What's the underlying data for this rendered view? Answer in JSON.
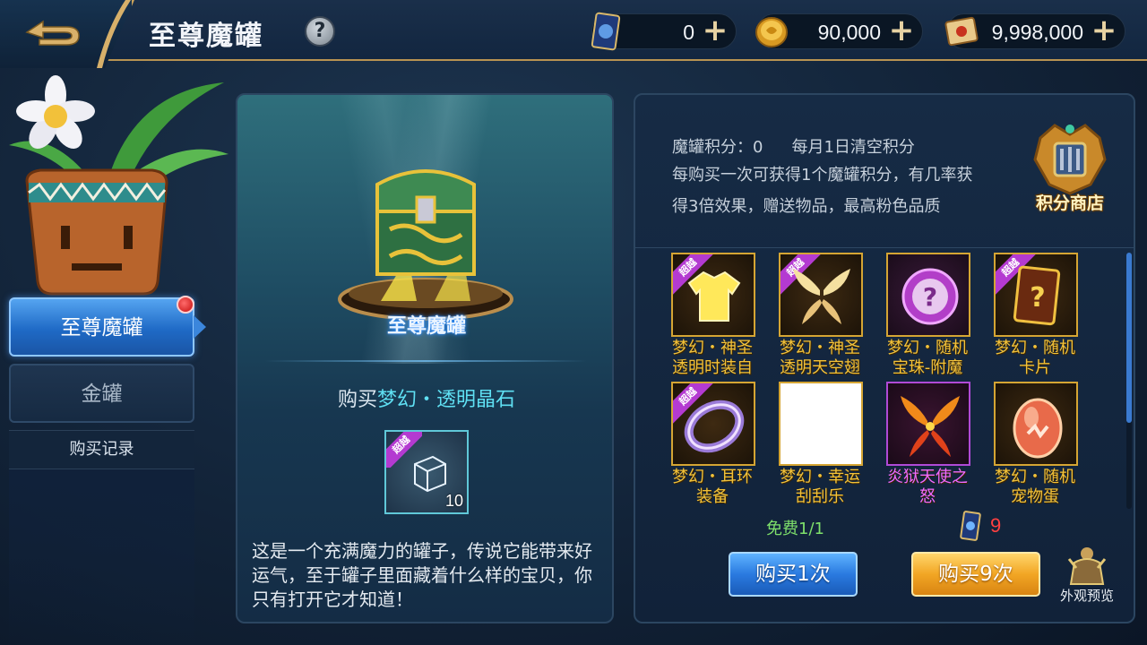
{
  "header": {
    "title": "至尊魔罐",
    "help_label": "?",
    "resources": [
      {
        "icon": "card-icon",
        "value": "0"
      },
      {
        "icon": "gold-coin-icon",
        "value": "90,000"
      },
      {
        "icon": "scroll-icon",
        "value": "9,998,000"
      }
    ],
    "plus_label": "+"
  },
  "sidebar": {
    "tabs": [
      {
        "label": "至尊魔罐",
        "active": true,
        "has_alert": true
      },
      {
        "label": "金罐",
        "active": false
      }
    ],
    "history_label": "购买记录"
  },
  "center": {
    "chest_name": "至尊魔罐",
    "buy_prefix": "购买",
    "buy_item": "梦幻・透明晶石",
    "item_badge": "超越",
    "item_count": "10",
    "description": "这是一个充满魔力的罐子，传说它能带来好运气，至于罐子里面藏着什么样的宝贝，你只有打开它才知道！"
  },
  "right": {
    "score_label": "魔罐积分：0",
    "reset_note": "每月1日清空积分",
    "info": "每购买一次可获得1个魔罐积分，有几率获得3倍效果，赠送物品，最高粉色品质",
    "shop_label": "积分商店",
    "rewards": [
      {
        "name_line1": "梦幻・神圣",
        "name_line2": "透明时装自",
        "icon": "shirt-icon",
        "badge": "超越",
        "color": "gold"
      },
      {
        "name_line1": "梦幻・神圣",
        "name_line2": "透明天空翅",
        "icon": "wings-icon",
        "badge": "超越",
        "color": "gold"
      },
      {
        "name_line1": "梦幻・随机",
        "name_line2": "宝珠-附魔",
        "icon": "mystery-orb-icon",
        "badge": "",
        "color": "gold"
      },
      {
        "name_line1": "梦幻・随机",
        "name_line2": "卡片",
        "icon": "mystery-card-icon",
        "badge": "超越",
        "color": "gold"
      },
      {
        "name_line1": "梦幻・耳环",
        "name_line2": "装备",
        "icon": "earring-icon",
        "badge": "超越",
        "color": "gold"
      },
      {
        "name_line1": "梦幻・幸运",
        "name_line2": "刮刮乐",
        "icon": "blank-ticket-icon",
        "badge": "",
        "color": "gold"
      },
      {
        "name_line1": "炎狱天使之",
        "name_line2": "怒",
        "icon": "fire-wings-icon",
        "badge": "",
        "color": "pink"
      },
      {
        "name_line1": "梦幻・随机",
        "name_line2": "宠物蛋",
        "icon": "pet-egg-icon",
        "badge": "",
        "color": "gold"
      }
    ],
    "free_label": "免费1/1",
    "cost_value": "9",
    "buy1_label": "购买1次",
    "buy9_label": "购买9次",
    "preview_label": "外观预览"
  }
}
